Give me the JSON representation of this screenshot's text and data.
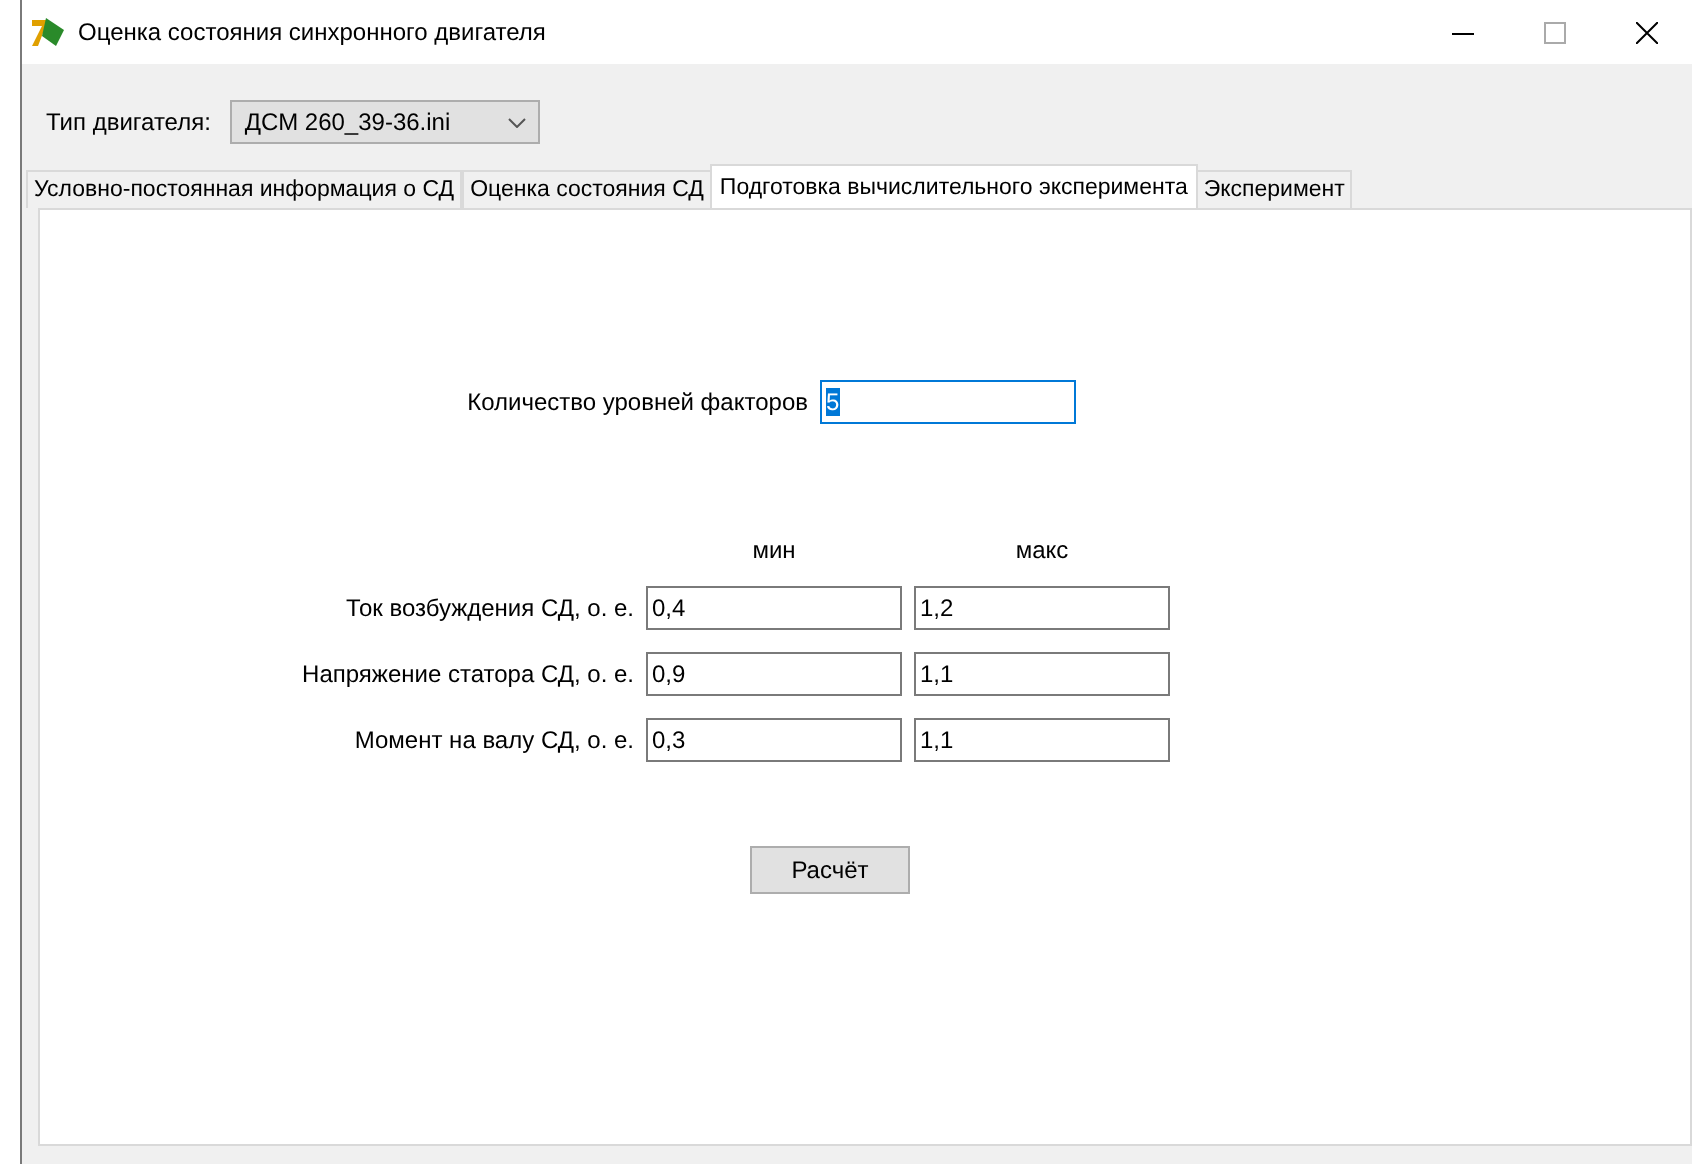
{
  "window": {
    "title": "Оценка состояния синхронного двигателя"
  },
  "engine_type": {
    "label": "Тип двигателя:",
    "value": "ДСМ 260_39-36.ini"
  },
  "tabs": [
    {
      "label": "Условно-постоянная информация о СД",
      "selected": false
    },
    {
      "label": "Оценка состояния СД",
      "selected": false
    },
    {
      "label": "Подготовка вычислительного эксперимента",
      "selected": true
    },
    {
      "label": "Эксперимент",
      "selected": false
    }
  ],
  "factor_levels": {
    "label": "Количество уровней факторов",
    "value": "5",
    "text_selected": true
  },
  "columns": [
    "мин",
    "макс"
  ],
  "factors": [
    {
      "label": "Ток возбуждения СД, о. е.",
      "min": "0,4",
      "max": "1,2"
    },
    {
      "label": "Напряжение статора СД, о. е.",
      "min": "0,9",
      "max": "1,1"
    },
    {
      "label": "Момент на валу СД, о. е.",
      "min": "0,3",
      "max": "1,1"
    }
  ],
  "calculate_button": "Расчёт"
}
